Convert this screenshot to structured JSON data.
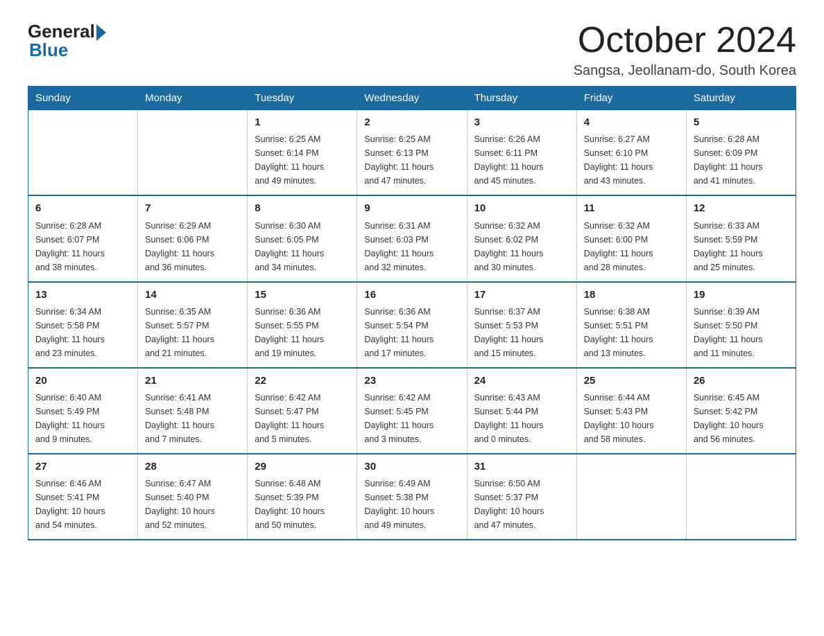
{
  "logo": {
    "general": "General",
    "blue": "Blue"
  },
  "title": "October 2024",
  "subtitle": "Sangsa, Jeollanam-do, South Korea",
  "days_of_week": [
    "Sunday",
    "Monday",
    "Tuesday",
    "Wednesday",
    "Thursday",
    "Friday",
    "Saturday"
  ],
  "weeks": [
    [
      {
        "day": "",
        "info": ""
      },
      {
        "day": "",
        "info": ""
      },
      {
        "day": "1",
        "info": "Sunrise: 6:25 AM\nSunset: 6:14 PM\nDaylight: 11 hours\nand 49 minutes."
      },
      {
        "day": "2",
        "info": "Sunrise: 6:25 AM\nSunset: 6:13 PM\nDaylight: 11 hours\nand 47 minutes."
      },
      {
        "day": "3",
        "info": "Sunrise: 6:26 AM\nSunset: 6:11 PM\nDaylight: 11 hours\nand 45 minutes."
      },
      {
        "day": "4",
        "info": "Sunrise: 6:27 AM\nSunset: 6:10 PM\nDaylight: 11 hours\nand 43 minutes."
      },
      {
        "day": "5",
        "info": "Sunrise: 6:28 AM\nSunset: 6:09 PM\nDaylight: 11 hours\nand 41 minutes."
      }
    ],
    [
      {
        "day": "6",
        "info": "Sunrise: 6:28 AM\nSunset: 6:07 PM\nDaylight: 11 hours\nand 38 minutes."
      },
      {
        "day": "7",
        "info": "Sunrise: 6:29 AM\nSunset: 6:06 PM\nDaylight: 11 hours\nand 36 minutes."
      },
      {
        "day": "8",
        "info": "Sunrise: 6:30 AM\nSunset: 6:05 PM\nDaylight: 11 hours\nand 34 minutes."
      },
      {
        "day": "9",
        "info": "Sunrise: 6:31 AM\nSunset: 6:03 PM\nDaylight: 11 hours\nand 32 minutes."
      },
      {
        "day": "10",
        "info": "Sunrise: 6:32 AM\nSunset: 6:02 PM\nDaylight: 11 hours\nand 30 minutes."
      },
      {
        "day": "11",
        "info": "Sunrise: 6:32 AM\nSunset: 6:00 PM\nDaylight: 11 hours\nand 28 minutes."
      },
      {
        "day": "12",
        "info": "Sunrise: 6:33 AM\nSunset: 5:59 PM\nDaylight: 11 hours\nand 25 minutes."
      }
    ],
    [
      {
        "day": "13",
        "info": "Sunrise: 6:34 AM\nSunset: 5:58 PM\nDaylight: 11 hours\nand 23 minutes."
      },
      {
        "day": "14",
        "info": "Sunrise: 6:35 AM\nSunset: 5:57 PM\nDaylight: 11 hours\nand 21 minutes."
      },
      {
        "day": "15",
        "info": "Sunrise: 6:36 AM\nSunset: 5:55 PM\nDaylight: 11 hours\nand 19 minutes."
      },
      {
        "day": "16",
        "info": "Sunrise: 6:36 AM\nSunset: 5:54 PM\nDaylight: 11 hours\nand 17 minutes."
      },
      {
        "day": "17",
        "info": "Sunrise: 6:37 AM\nSunset: 5:53 PM\nDaylight: 11 hours\nand 15 minutes."
      },
      {
        "day": "18",
        "info": "Sunrise: 6:38 AM\nSunset: 5:51 PM\nDaylight: 11 hours\nand 13 minutes."
      },
      {
        "day": "19",
        "info": "Sunrise: 6:39 AM\nSunset: 5:50 PM\nDaylight: 11 hours\nand 11 minutes."
      }
    ],
    [
      {
        "day": "20",
        "info": "Sunrise: 6:40 AM\nSunset: 5:49 PM\nDaylight: 11 hours\nand 9 minutes."
      },
      {
        "day": "21",
        "info": "Sunrise: 6:41 AM\nSunset: 5:48 PM\nDaylight: 11 hours\nand 7 minutes."
      },
      {
        "day": "22",
        "info": "Sunrise: 6:42 AM\nSunset: 5:47 PM\nDaylight: 11 hours\nand 5 minutes."
      },
      {
        "day": "23",
        "info": "Sunrise: 6:42 AM\nSunset: 5:45 PM\nDaylight: 11 hours\nand 3 minutes."
      },
      {
        "day": "24",
        "info": "Sunrise: 6:43 AM\nSunset: 5:44 PM\nDaylight: 11 hours\nand 0 minutes."
      },
      {
        "day": "25",
        "info": "Sunrise: 6:44 AM\nSunset: 5:43 PM\nDaylight: 10 hours\nand 58 minutes."
      },
      {
        "day": "26",
        "info": "Sunrise: 6:45 AM\nSunset: 5:42 PM\nDaylight: 10 hours\nand 56 minutes."
      }
    ],
    [
      {
        "day": "27",
        "info": "Sunrise: 6:46 AM\nSunset: 5:41 PM\nDaylight: 10 hours\nand 54 minutes."
      },
      {
        "day": "28",
        "info": "Sunrise: 6:47 AM\nSunset: 5:40 PM\nDaylight: 10 hours\nand 52 minutes."
      },
      {
        "day": "29",
        "info": "Sunrise: 6:48 AM\nSunset: 5:39 PM\nDaylight: 10 hours\nand 50 minutes."
      },
      {
        "day": "30",
        "info": "Sunrise: 6:49 AM\nSunset: 5:38 PM\nDaylight: 10 hours\nand 49 minutes."
      },
      {
        "day": "31",
        "info": "Sunrise: 6:50 AM\nSunset: 5:37 PM\nDaylight: 10 hours\nand 47 minutes."
      },
      {
        "day": "",
        "info": ""
      },
      {
        "day": "",
        "info": ""
      }
    ]
  ]
}
